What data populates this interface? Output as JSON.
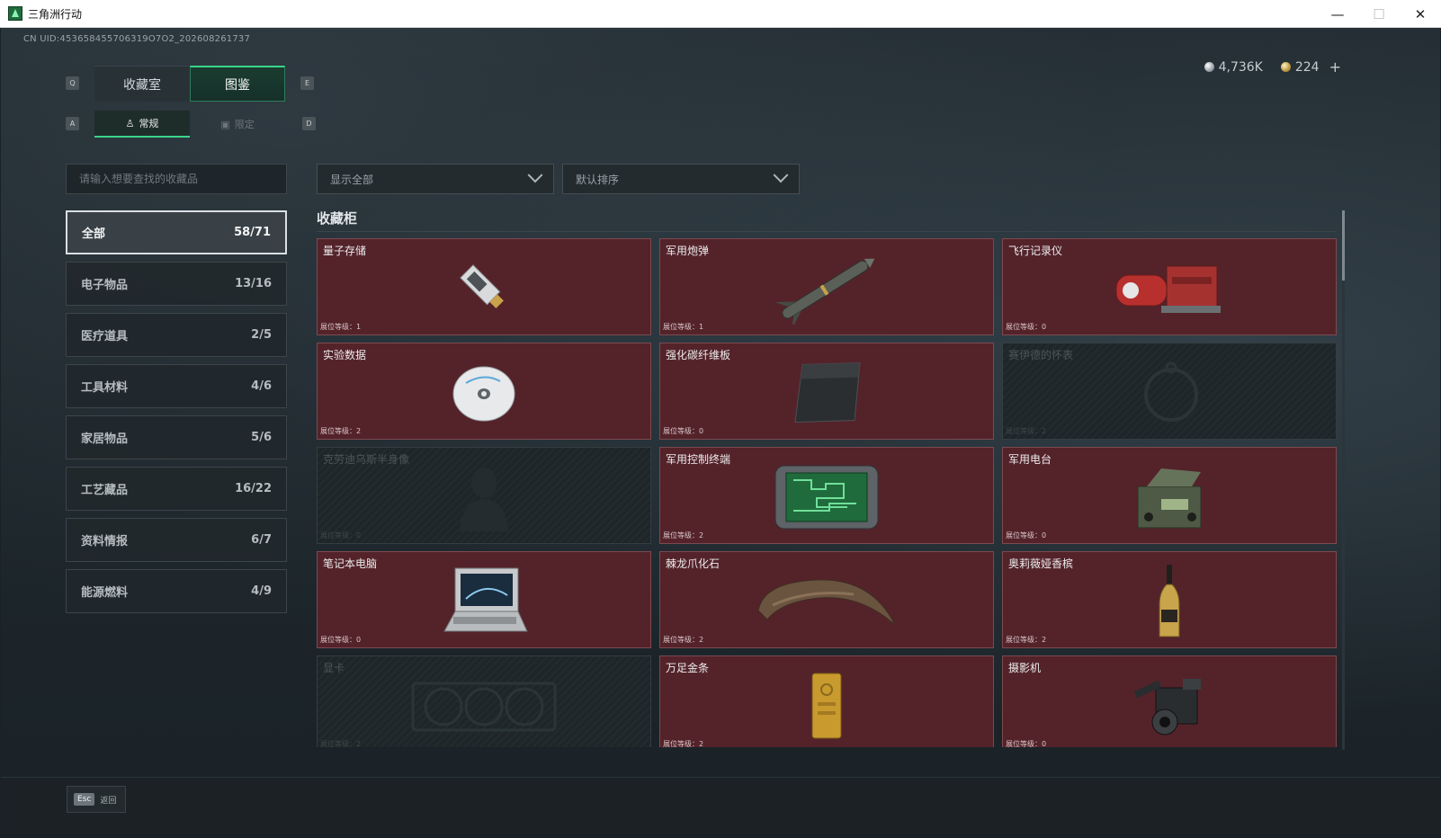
{
  "window": {
    "title": "三角洲行动",
    "controls": [
      "—",
      "☐",
      "✕"
    ]
  },
  "uid": "CN UID:453658455706319O7O2_202608261737",
  "currency": {
    "silver": "4,736K",
    "gold": "224",
    "plus": "+"
  },
  "keys": {
    "tab_prev": "Q",
    "tab_next": "E",
    "sub_prev": "A",
    "sub_next": "D"
  },
  "tabs": [
    {
      "label": "收藏室"
    },
    {
      "label": "图鉴"
    }
  ],
  "subtabs": [
    {
      "label": "常规"
    },
    {
      "label": "限定"
    }
  ],
  "search": {
    "placeholder": "请输入想要查找的收藏品"
  },
  "filters": {
    "show": "显示全部",
    "sort": "默认排序"
  },
  "categories": [
    {
      "label": "全部",
      "count": "58/71"
    },
    {
      "label": "电子物品",
      "count": "13/16"
    },
    {
      "label": "医疗道具",
      "count": "2/5"
    },
    {
      "label": "工具材料",
      "count": "4/6"
    },
    {
      "label": "家居物品",
      "count": "5/6"
    },
    {
      "label": "工艺藏品",
      "count": "16/22"
    },
    {
      "label": "资料情报",
      "count": "6/7"
    },
    {
      "label": "能源燃料",
      "count": "4/9"
    }
  ],
  "section": {
    "title": "收藏柜"
  },
  "items": [
    {
      "name": "量子存储",
      "level": "展位等级：1",
      "icon": "usb-drive-icon"
    },
    {
      "name": "军用炮弹",
      "level": "展位等级：1",
      "icon": "missile-icon"
    },
    {
      "name": "飞行记录仪",
      "level": "展位等级：0",
      "icon": "flight-recorder-icon"
    },
    {
      "name": "实验数据",
      "level": "展位等级：2",
      "icon": "disc-icon"
    },
    {
      "name": "强化碳纤维板",
      "level": "展位等级：0",
      "icon": "carbon-plate-icon"
    },
    {
      "name": "赛伊德的怀表",
      "level": "展位等级：2",
      "icon": "pocket-watch-icon"
    },
    {
      "name": "克劳迪乌斯半身像",
      "level": "展位等级：0",
      "icon": "bust-icon"
    },
    {
      "name": "军用控制终端",
      "level": "展位等级：2",
      "icon": "terminal-icon"
    },
    {
      "name": "军用电台",
      "level": "展位等级：0",
      "icon": "radio-icon"
    },
    {
      "name": "笔记本电脑",
      "level": "展位等级：0",
      "icon": "laptop-icon"
    },
    {
      "name": "棘龙爪化石",
      "level": "展位等级：2",
      "icon": "claw-fossil-icon"
    },
    {
      "name": "奥莉薇娅香槟",
      "level": "展位等级：2",
      "icon": "champagne-icon"
    },
    {
      "name": "显卡",
      "level": "展位等级：2",
      "icon": "gpu-icon"
    },
    {
      "name": "万足金条",
      "level": "展位等级：2",
      "icon": "gold-bar-icon"
    },
    {
      "name": "摄影机",
      "level": "展位等级：0",
      "icon": "camera-icon"
    }
  ],
  "footer": {
    "key": "Esc",
    "label": "返回"
  },
  "colors": {
    "accent": "#3ad58a",
    "card_red": "#54232a",
    "card_locked": "#1e2629"
  }
}
